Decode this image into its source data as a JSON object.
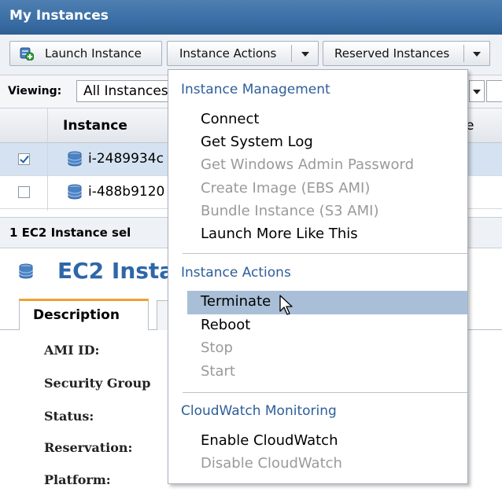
{
  "window": {
    "title": "My Instances"
  },
  "toolbar": {
    "launch_label": "Launch Instance",
    "actions_label": "Instance Actions",
    "reserved_label": "Reserved Instances"
  },
  "viewing": {
    "label": "Viewing:",
    "value": "All Instances"
  },
  "table": {
    "columns": [
      "Instance",
      "e"
    ],
    "rows": [
      {
        "id": "i-2489934c",
        "checked": true
      },
      {
        "id": "i-488b9120",
        "checked": false
      }
    ]
  },
  "selection": {
    "text": "1 EC2 Instance sel"
  },
  "detail": {
    "title": "EC2 Instar",
    "tabs": [
      "Description"
    ],
    "fields": [
      "AMI ID:",
      "Security Group",
      "Status:",
      "Reservation:",
      "Platform:"
    ]
  },
  "menu": {
    "sections": [
      {
        "title": "Instance Management",
        "items": [
          {
            "label": "Connect",
            "enabled": true
          },
          {
            "label": "Get System Log",
            "enabled": true
          },
          {
            "label": "Get Windows Admin Password",
            "enabled": false
          },
          {
            "label": "Create Image (EBS AMI)",
            "enabled": false
          },
          {
            "label": "Bundle Instance (S3 AMI)",
            "enabled": false
          },
          {
            "label": "Launch More Like This",
            "enabled": true
          }
        ]
      },
      {
        "title": "Instance Actions",
        "items": [
          {
            "label": "Terminate",
            "enabled": true,
            "highlighted": true
          },
          {
            "label": "Reboot",
            "enabled": true
          },
          {
            "label": "Stop",
            "enabled": false
          },
          {
            "label": "Start",
            "enabled": false
          }
        ]
      },
      {
        "title": "CloudWatch Monitoring",
        "items": [
          {
            "label": "Enable CloudWatch",
            "enabled": true
          },
          {
            "label": "Disable CloudWatch",
            "enabled": false
          }
        ]
      }
    ]
  },
  "colors": {
    "title_bar": "#3a6ea5",
    "section_heading": "#2d5e9a",
    "highlight": "#a9bfd8",
    "tab_accent": "#f0a030",
    "disabled_text": "#9a9a9a"
  }
}
